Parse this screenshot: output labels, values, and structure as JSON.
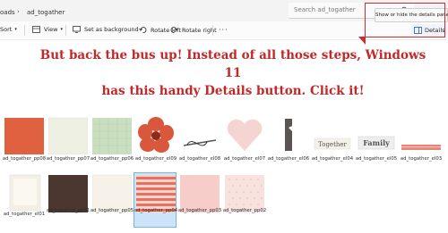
{
  "address_bar": {
    "root": "oads",
    "current_folder": "ad_togather",
    "search_placeholder": "Search ad_togather"
  },
  "tooltip": "Show or hide the details pane.",
  "toolbar": {
    "sort": "Sort",
    "view": "View",
    "set_background": "Set as background",
    "rotate_left": "Rotate left",
    "rotate_right": "Rotate right",
    "details": "Details"
  },
  "caption": {
    "line1": "But back the bus up! Instead of all those steps, Windows 11",
    "line2": "has this handy Details button. Click it!"
  },
  "files_row1": [
    {
      "label": "ad_togather_pp08",
      "icon": "orange-paper"
    },
    {
      "label": "ad_togather_pp07",
      "icon": "cream-paper"
    },
    {
      "label": "ad_togather_pp06",
      "icon": "green-paper"
    },
    {
      "label": "ad_togather_el09",
      "icon": "red-flower"
    },
    {
      "label": "ad_togather_el08",
      "icon": "needle-thread"
    },
    {
      "label": "ad_togather_el07",
      "icon": "pink-heart"
    },
    {
      "label": "ad_togather_el06",
      "icon": "bracket-clip"
    },
    {
      "label": "ad_togather_el04",
      "icon": "together-label"
    },
    {
      "label": "ad_togather_el05",
      "icon": "family-label"
    },
    {
      "label": "ad_togather_el03",
      "icon": "ribbon-strip"
    }
  ],
  "files_row2": [
    {
      "label": "ad_togather_el01",
      "icon": "cream-frame"
    },
    {
      "label": "ad_togather_pp01",
      "icon": "brown-paper"
    },
    {
      "label": "ad_togather_pp05",
      "icon": "ivory-paper"
    },
    {
      "label": "ad_togather_pp04",
      "icon": "striped-paper"
    },
    {
      "label": "ad_togather_pp03",
      "icon": "pink-paper"
    },
    {
      "label": "ad_togather_pp02",
      "icon": "pink-dot-paper"
    }
  ],
  "thumb_labels": {
    "together": "Together",
    "family": "Family"
  },
  "colors": {
    "caption": "#c02929",
    "callout": "#d22a2a",
    "selection": "#cce4f7"
  }
}
